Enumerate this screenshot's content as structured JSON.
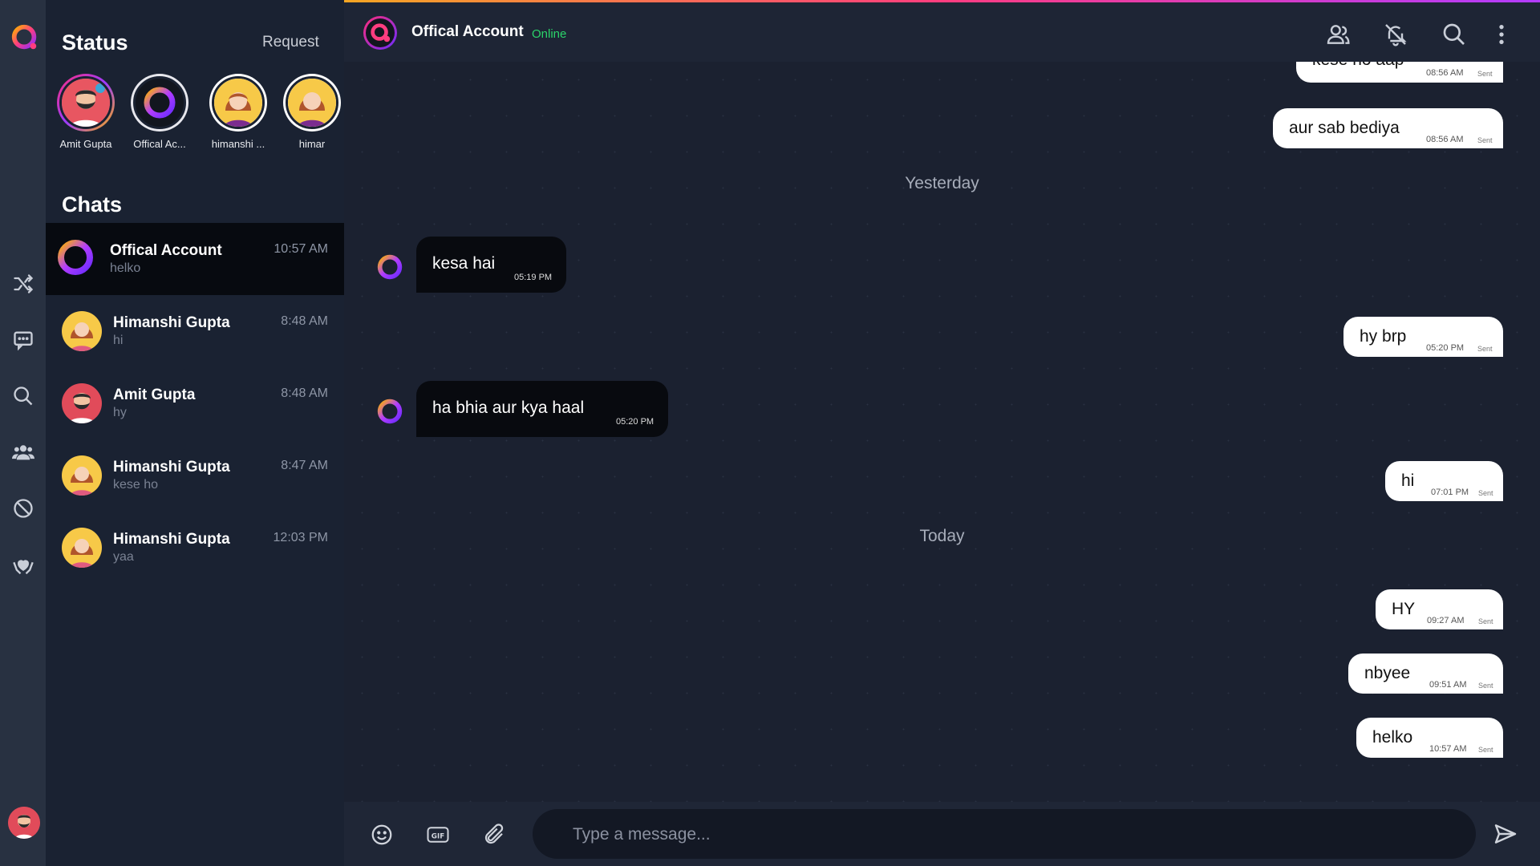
{
  "sidebar": {
    "status_title": "Status",
    "request_label": "Request",
    "chats_title": "Chats",
    "stories": [
      {
        "name": "Amit Gupta"
      },
      {
        "name": "Offical Ac..."
      },
      {
        "name": "himanshi ..."
      },
      {
        "name": "himar"
      }
    ],
    "chats": [
      {
        "name": "Offical Account",
        "preview": "helko",
        "time": "10:57 AM"
      },
      {
        "name": "Himanshi Gupta",
        "preview": "hi",
        "time": "8:48 AM"
      },
      {
        "name": "Amit Gupta",
        "preview": "hy",
        "time": "8:48 AM"
      },
      {
        "name": "Himanshi Gupta",
        "preview": "kese ho",
        "time": "8:47 AM"
      },
      {
        "name": "Himanshi Gupta",
        "preview": "yaa",
        "time": "12:03 PM"
      }
    ]
  },
  "rail": {
    "icons": [
      "app-logo-icon",
      "shuffle-icon",
      "chat-icon",
      "search-icon",
      "group-icon",
      "block-icon",
      "heart-hands-icon",
      "user-avatar"
    ]
  },
  "header": {
    "name": "Offical Account",
    "status": "Online",
    "icons": [
      "contacts-icon",
      "mute-icon",
      "search-icon",
      "more-icon"
    ]
  },
  "messages": [
    {
      "dir": "out",
      "text": "kese ho aap",
      "time": "08:56 AM",
      "sent": "Sent"
    },
    {
      "dir": "out",
      "text": "aur sab bediya",
      "time": "08:56 AM",
      "sent": "Sent"
    },
    {
      "day": "Yesterday"
    },
    {
      "dir": "in",
      "text": "kesa hai",
      "time": "05:19 PM"
    },
    {
      "dir": "out",
      "text": "hy brp",
      "time": "05:20 PM",
      "sent": "Sent"
    },
    {
      "dir": "in",
      "text": "ha bhia aur kya haal",
      "time": "05:20 PM"
    },
    {
      "dir": "out",
      "text": "hi",
      "time": "07:01 PM",
      "sent": "Sent"
    },
    {
      "day": "Today"
    },
    {
      "dir": "out",
      "text": "HY",
      "time": "09:27 AM",
      "sent": "Sent"
    },
    {
      "dir": "out",
      "text": "nbyee",
      "time": "09:51 AM",
      "sent": "Sent"
    },
    {
      "dir": "out",
      "text": "helko",
      "time": "10:57 AM",
      "sent": "Sent"
    }
  ],
  "composer": {
    "placeholder": "Type a message...",
    "icons": [
      "emoji-icon",
      "gif-icon",
      "attach-icon",
      "send-icon"
    ]
  },
  "colors": {
    "accent_online": "#2bd46a",
    "rail_bg": "#283141",
    "sidebar_bg": "#1a2232",
    "chat_bg": "#1b2130"
  }
}
